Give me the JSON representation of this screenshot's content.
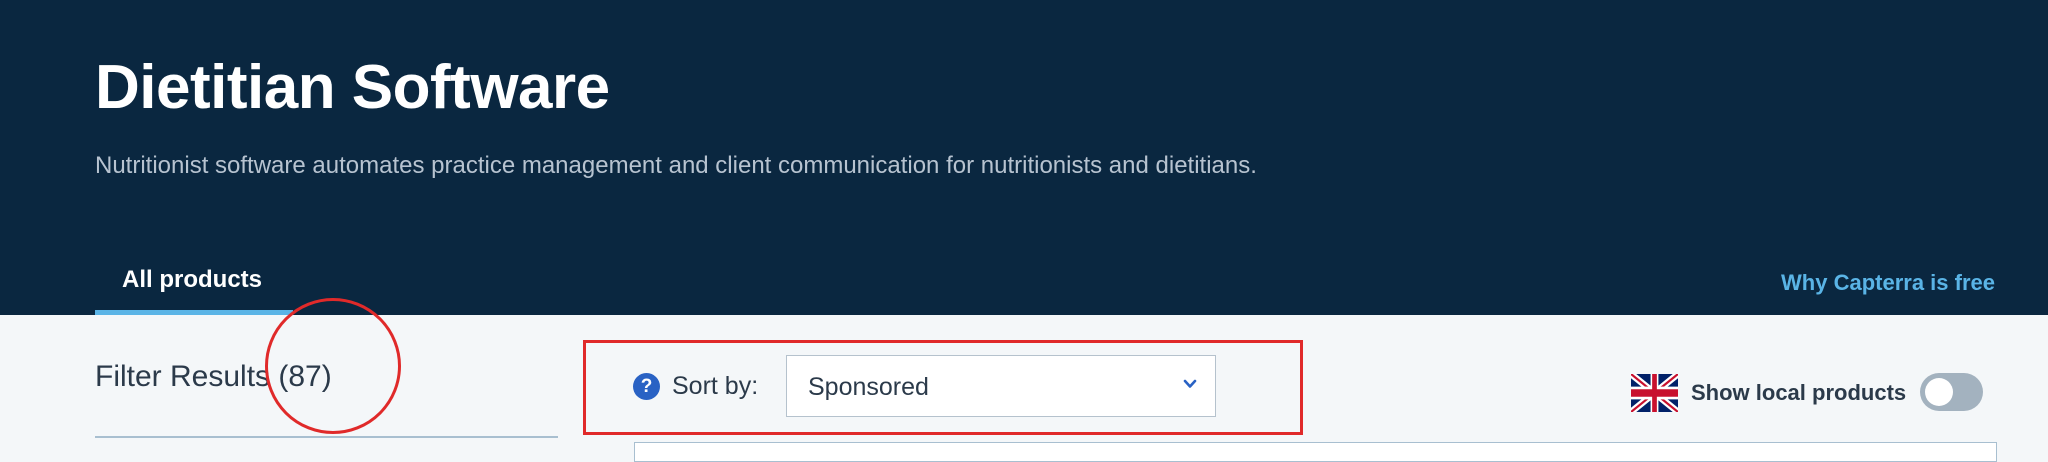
{
  "header": {
    "title": "Dietitian Software",
    "subtitle": "Nutritionist software automates practice management and client communication for nutritionists and dietitians."
  },
  "tabs": [
    {
      "label": "All products",
      "active": true
    }
  ],
  "why_link": "Why Capterra is free",
  "filter": {
    "title": "Filter Results (87)"
  },
  "sort": {
    "help_icon": "question-circle-icon",
    "label": "Sort by:",
    "selected": "Sponsored",
    "chevron_icon": "chevron-down-icon"
  },
  "local_products": {
    "flag_icon": "uk-flag-icon",
    "label": "Show local products",
    "enabled": false
  },
  "colors": {
    "hero_bg": "#0a2740",
    "accent": "#5ab4e6",
    "annotation": "#e02a2a",
    "help_blue": "#2962c4"
  }
}
